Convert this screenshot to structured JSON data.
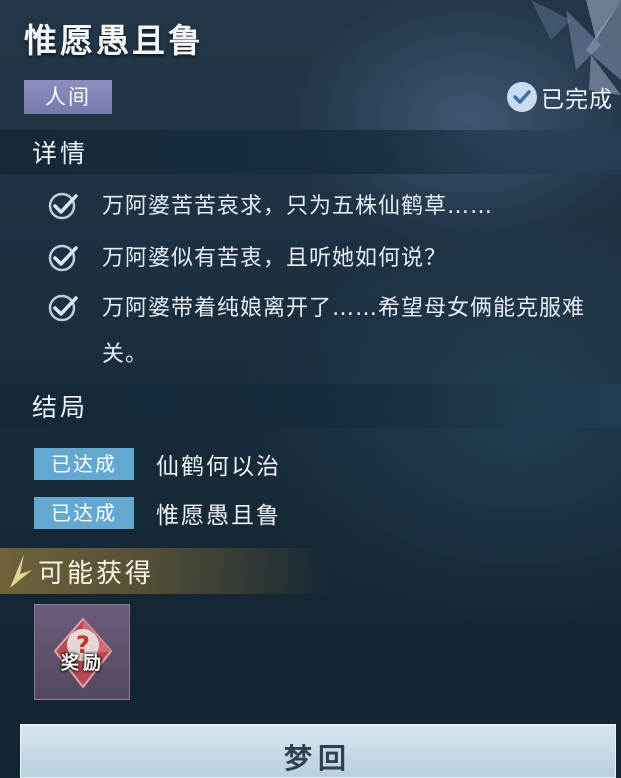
{
  "header": {
    "title": "惟愿愚且鲁",
    "region_tag": "人间",
    "status_text": "已完成",
    "status_icon": "check-circle-icon"
  },
  "details": {
    "heading": "详情",
    "items": [
      {
        "text": "万阿婆苦苦哀求，只为五株仙鹤草……",
        "icon": "check-icon"
      },
      {
        "text": "万阿婆似有苦衷，且听她如何说？",
        "icon": "check-icon"
      },
      {
        "text": "万阿婆带着纯娘离开了……希望母女俩能克服难关。",
        "icon": "check-icon"
      }
    ]
  },
  "endings": {
    "heading": "结局",
    "items": [
      {
        "badge": "已达成",
        "name": "仙鹤何以治"
      },
      {
        "badge": "已达成",
        "name": "惟愿愚且鲁"
      }
    ]
  },
  "rewards": {
    "heading": "可能获得",
    "items": [
      {
        "label": "奖励",
        "icon": "question-gem-icon"
      }
    ]
  },
  "footer": {
    "button_label": "梦回"
  },
  "colors": {
    "background": "#1d3142",
    "region_tag": "#8d8ec0",
    "ending_badge": "#63a8d0",
    "rewards_bar": "#786a3c",
    "button": "#c8dbe8"
  }
}
